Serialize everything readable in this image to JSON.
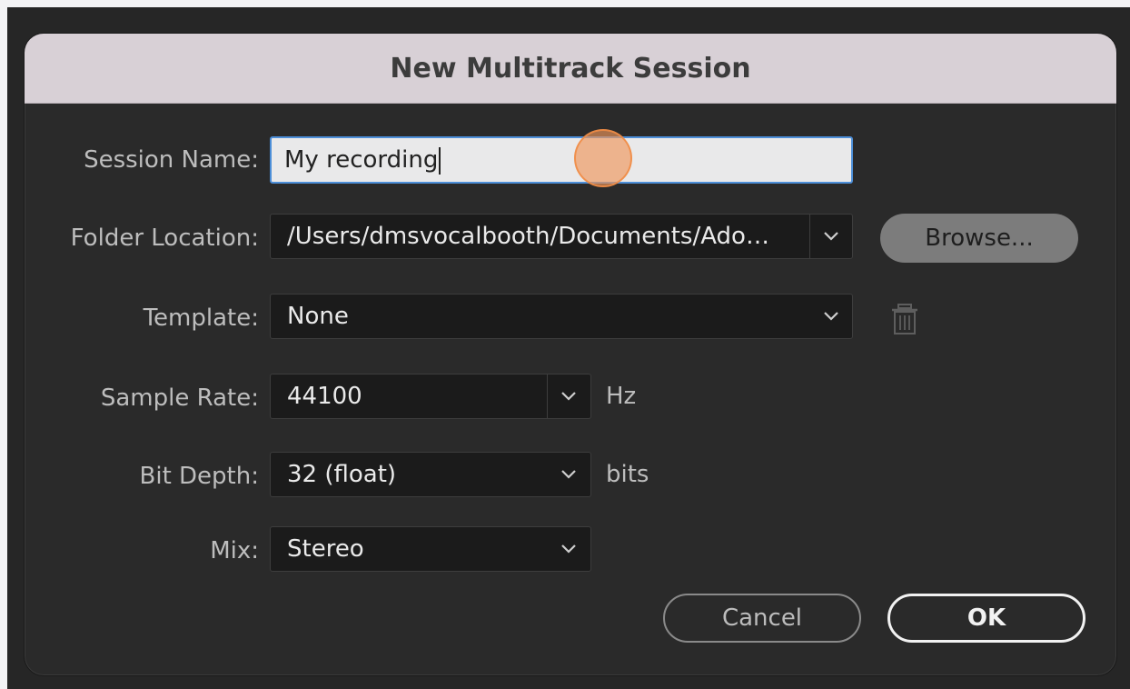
{
  "dialog": {
    "title": "New Multitrack Session"
  },
  "session_name": {
    "label": "Session Name:",
    "value": "My recording"
  },
  "folder_location": {
    "label": "Folder Location:",
    "value": "/Users/dmsvocalbooth/Documents/Ado…",
    "browse_label": "Browse..."
  },
  "template": {
    "label": "Template:",
    "value": "None"
  },
  "sample_rate": {
    "label": "Sample Rate:",
    "value": "44100",
    "unit": "Hz"
  },
  "bit_depth": {
    "label": "Bit Depth:",
    "value": "32 (float)",
    "unit": "bits"
  },
  "mix": {
    "label": "Mix:",
    "value": "Stereo"
  },
  "buttons": {
    "cancel": "Cancel",
    "ok": "OK"
  },
  "icons": {
    "dropdown": "chevron-down-icon",
    "delete": "trash-icon"
  },
  "colors": {
    "title_bar": "#d8d0d6",
    "focus_ring": "#4c8ed8",
    "dialog_bg": "#2a2a2a",
    "cursor_highlight": "#f0965a"
  }
}
